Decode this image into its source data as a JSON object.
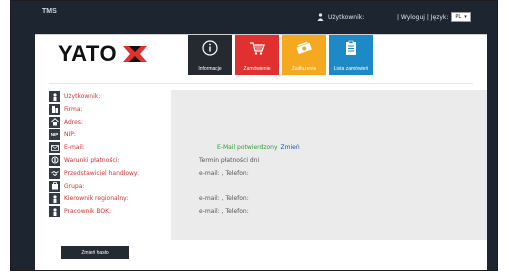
{
  "topbar": {
    "brand": "TMS",
    "user_label": "Użytkownik:",
    "logout_label": "| Wyloguj | Język:",
    "lang_value": "PL"
  },
  "logo": {
    "text": "YATO"
  },
  "tiles": [
    {
      "label": "Informacje",
      "icon": "info-icon"
    },
    {
      "label": "Zamówienie",
      "icon": "cart-icon"
    },
    {
      "label": "Zadłużenie",
      "icon": "money-icon"
    },
    {
      "label": "Lista zamówień",
      "icon": "clipboard-icon"
    }
  ],
  "rows": [
    {
      "icon": "person-icon",
      "label": "Użytkownik:",
      "value": ""
    },
    {
      "icon": "building-icon",
      "label": "Firma:",
      "value": ""
    },
    {
      "icon": "home-icon",
      "label": "Adres:",
      "value": ""
    },
    {
      "icon": "nip-icon",
      "label": "NIP:",
      "value": ""
    },
    {
      "icon": "envelope-icon",
      "label": "E-mail:",
      "value": "E-Mail potwierdzony",
      "link": "Zmień"
    },
    {
      "icon": "payment-icon",
      "label": "Warunki płatności:",
      "value": "Termin płatności     dni"
    },
    {
      "icon": "handshake-icon",
      "label": "Przedstawiciel handlowy:",
      "value": "e-mail: , Telefon:"
    },
    {
      "icon": "group-icon",
      "label": "Grupa:",
      "value": ""
    },
    {
      "icon": "manager-icon",
      "label": "Kierownik regionalny:",
      "value": "e-mail: , Telefon:"
    },
    {
      "icon": "worker-icon",
      "label": "Pracownik BOK:",
      "value": "e-mail: , Telefon:"
    }
  ],
  "button": {
    "change_password": "Zmień hasło"
  },
  "colors": {
    "accent_red": "#e0302f",
    "accent_orange": "#f4a91f",
    "accent_blue": "#1e89c7",
    "dark": "#252a31",
    "label_red": "#d33333",
    "confirmed_green": "#2e9c3a"
  }
}
